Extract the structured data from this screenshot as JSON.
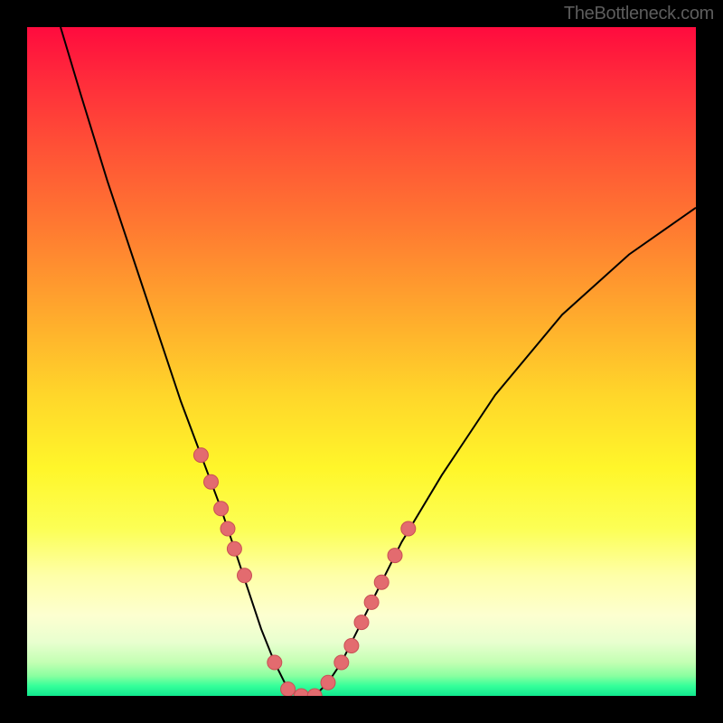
{
  "watermark": "TheBottleneck.com",
  "colors": {
    "frame": "#000000",
    "gradient_top": "#ff0b3e",
    "gradient_bottom": "#11e88e",
    "curve": "#000000",
    "marker_fill": "#e36b6f",
    "marker_stroke": "#c94f54"
  },
  "chart_data": {
    "type": "line",
    "title": "",
    "xlabel": "",
    "ylabel": "",
    "xlim": [
      0,
      100
    ],
    "ylim": [
      0,
      100
    ],
    "series": [
      {
        "name": "bottleneck-curve",
        "comment": "y is bottleneck percentage (0 at bottom/green, 100 at top/red). Curve drops steeply from left, bottoms near x≈40, rises more gently toward right edge reaching ~73.",
        "x": [
          5,
          8,
          12,
          16,
          20,
          23,
          26,
          29,
          31,
          33,
          35,
          37,
          39,
          41,
          43,
          45,
          47,
          49,
          52,
          56,
          62,
          70,
          80,
          90,
          100
        ],
        "y": [
          100,
          90,
          77,
          65,
          53,
          44,
          36,
          28,
          22,
          16,
          10,
          5,
          1,
          0,
          0,
          2,
          5,
          9,
          15,
          23,
          33,
          45,
          57,
          66,
          73
        ]
      }
    ],
    "markers": {
      "comment": "Pink dots clustered on both flanks of the valley, roughly between y=5 and y=30.",
      "x": [
        26,
        27.5,
        29,
        30,
        31,
        32.5,
        37,
        39,
        41,
        43,
        45,
        47,
        48.5,
        50,
        51.5,
        53,
        55,
        57
      ],
      "y": [
        36,
        32,
        28,
        25,
        22,
        18,
        5,
        1,
        0,
        0,
        2,
        5,
        7.5,
        11,
        14,
        17,
        21,
        25
      ]
    }
  }
}
